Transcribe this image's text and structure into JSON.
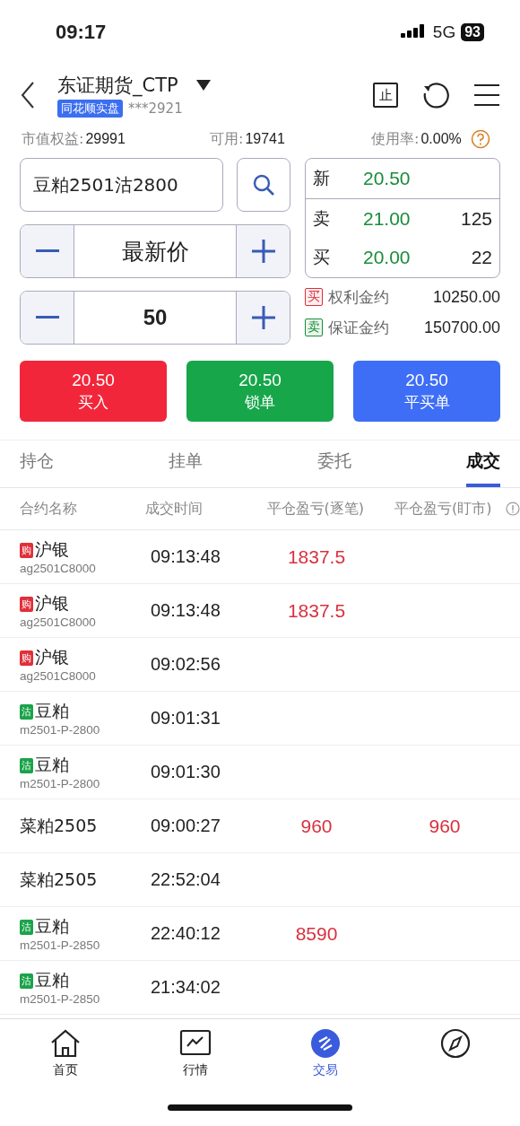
{
  "status_bar": {
    "time": "09:17",
    "network": "5G",
    "battery": "93"
  },
  "header": {
    "title": "东证期货_CTP",
    "badge": "同花顺实盘",
    "account": "***2921",
    "stop_icon": "止"
  },
  "summary": [
    {
      "label": "市值权益:",
      "value": "29991"
    },
    {
      "label": "可用:",
      "value": "19741"
    },
    {
      "label": "使用率:",
      "value": "0.00%"
    }
  ],
  "order": {
    "contract": "豆粕2501沽2800",
    "price_mode": "最新价",
    "quantity": "50"
  },
  "quote": {
    "last": {
      "label": "新",
      "price": "20.50"
    },
    "levels": [
      {
        "label": "卖",
        "price": "21.00",
        "volume": "125"
      },
      {
        "label": "买",
        "price": "20.00",
        "volume": "22"
      }
    ]
  },
  "margins": [
    {
      "tag": "买",
      "kind": "buy",
      "label": "权利金约",
      "value": "10250.00"
    },
    {
      "tag": "卖",
      "kind": "sell",
      "label": "保证金约",
      "value": "150700.00"
    }
  ],
  "actions": [
    {
      "price": "20.50",
      "label": "买入",
      "kind": "buy"
    },
    {
      "price": "20.50",
      "label": "锁单",
      "kind": "lock"
    },
    {
      "price": "20.50",
      "label": "平买单",
      "kind": "close"
    }
  ],
  "tabs": [
    {
      "label": "持仓",
      "selected": false
    },
    {
      "label": "挂单",
      "selected": false
    },
    {
      "label": "委托",
      "selected": false
    },
    {
      "label": "成交",
      "selected": true
    }
  ],
  "table": {
    "columns": [
      "合约名称",
      "成交时间",
      "平仓盈亏(逐笔)",
      "平仓盈亏(盯市)"
    ],
    "rows": [
      {
        "tag": "购",
        "kind": "call",
        "name": "沪银",
        "code": "ag2501C8000",
        "time": "09:13:48",
        "pnl_trade": "1837.5"
      },
      {
        "tag": "购",
        "kind": "call",
        "name": "沪银",
        "code": "ag2501C8000",
        "time": "09:13:48",
        "pnl_trade": "1837.5"
      },
      {
        "tag": "购",
        "kind": "call",
        "name": "沪银",
        "code": "ag2501C8000",
        "time": "09:02:56"
      },
      {
        "tag": "沽",
        "kind": "put",
        "name": "豆粕",
        "code": "m2501-P-2800",
        "time": "09:01:31"
      },
      {
        "tag": "沽",
        "kind": "put",
        "name": "豆粕",
        "code": "m2501-P-2800",
        "time": "09:01:30"
      },
      {
        "kind": "future",
        "name": "菜粕2505",
        "time": "09:00:27",
        "pnl_trade": "960",
        "pnl_market": "960"
      },
      {
        "kind": "future",
        "name": "菜粕2505",
        "time": "22:52:04"
      },
      {
        "tag": "沽",
        "kind": "put",
        "name": "豆粕",
        "code": "m2501-P-2850",
        "time": "22:40:12",
        "pnl_trade": "8590"
      },
      {
        "tag": "沽",
        "kind": "put",
        "name": "豆粕",
        "code": "m2501-P-2850",
        "time": "21:34:02"
      }
    ]
  },
  "nav": [
    {
      "label": "首页",
      "kind": "home",
      "selected": false
    },
    {
      "label": "行情",
      "kind": "chart",
      "selected": false
    },
    {
      "label": "交易",
      "kind": "trade",
      "selected": true
    },
    {
      "kind": "compass",
      "selected": false
    }
  ]
}
